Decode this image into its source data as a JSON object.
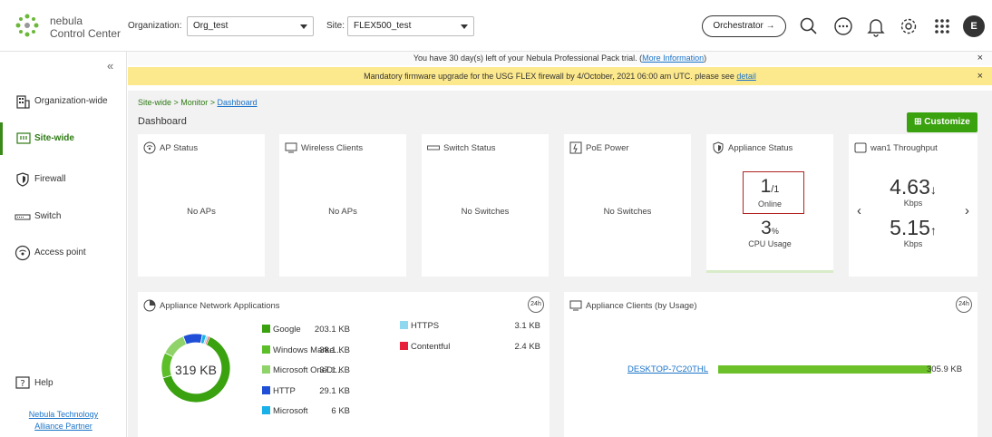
{
  "brand": {
    "line1": "nebula",
    "line2": "Control Center"
  },
  "topbar": {
    "org_label": "Organization:",
    "org_value": "Org_test",
    "site_label": "Site:",
    "site_value": "FLEX500_test",
    "orchestrator_label": "Orchestrator →",
    "avatar_initial": "E"
  },
  "sidebar": {
    "items": [
      {
        "label": "Organization-wide"
      },
      {
        "label": "Site-wide"
      },
      {
        "label": "Firewall"
      },
      {
        "label": "Switch"
      },
      {
        "label": "Access point"
      }
    ],
    "help_label": "Help",
    "partner_line1": "Nebula Technology",
    "partner_line2": "Alliance Partner"
  },
  "banners": {
    "trial_prefix": "You have 30 day(s) left of your Nebula Professional Pack trial. (",
    "trial_link": "More Information",
    "trial_suffix": ")",
    "firmware_prefix": "Mandatory firmware upgrade for the USG FLEX firewall by 4/October, 2021 06:00 am UTC. please see ",
    "firmware_link": "detail",
    "close": "×"
  },
  "breadcrumb": {
    "part1": "Site-wide > Monitor > ",
    "link": "Dashboard"
  },
  "page_title": "Dashboard",
  "customize_label": "Customize",
  "cards": {
    "ap_status": {
      "title": "AP Status",
      "body": "No APs"
    },
    "wireless_clients": {
      "title": "Wireless Clients",
      "body": "No APs"
    },
    "switch_status": {
      "title": "Switch Status",
      "body": "No Switches"
    },
    "poe_power": {
      "title": "PoE Power",
      "body": "No Switches"
    },
    "appliance_status": {
      "title": "Appliance Status",
      "online_num": "1",
      "online_den": "/1",
      "online_label": "Online",
      "cpu_value": "3",
      "cpu_unit": "%",
      "cpu_label": "CPU Usage"
    },
    "throughput": {
      "title": "wan1 Throughput",
      "down_value": "4.63",
      "down_arrow": "↓",
      "down_unit": "Kbps",
      "up_value": "5.15",
      "up_arrow": "↑",
      "up_unit": "Kbps",
      "prev": "‹",
      "next": "›"
    },
    "net_apps": {
      "title": "Appliance Network Applications",
      "badge": "24h",
      "total": "319 KB",
      "apps": [
        {
          "name": "Google",
          "value": "203.1 KB",
          "color": "#3aa10f"
        },
        {
          "name": "Windows Marke...",
          "value": "38.1 KB",
          "color": "#5cbf2a"
        },
        {
          "name": "Microsoft OneDr...",
          "value": "37.1 KB",
          "color": "#8fd36a"
        },
        {
          "name": "HTTP",
          "value": "29.1 KB",
          "color": "#1f4fd6"
        },
        {
          "name": "Microsoft",
          "value": "6 KB",
          "color": "#1ab0e8"
        },
        {
          "name": "HTTPS",
          "value": "3.1 KB",
          "color": "#8fd8f0"
        },
        {
          "name": "Contentful",
          "value": "2.4 KB",
          "color": "#e8213a"
        }
      ]
    },
    "clients": {
      "title": "Appliance Clients (by Usage)",
      "badge": "24h",
      "rows": [
        {
          "name": "DESKTOP-7C20THL",
          "value": "305.9 KB",
          "fraction": 1.0
        }
      ]
    }
  },
  "colors": {
    "accent": "#3aa10f",
    "banner": "#fde98d",
    "highlight": "#b22222"
  }
}
